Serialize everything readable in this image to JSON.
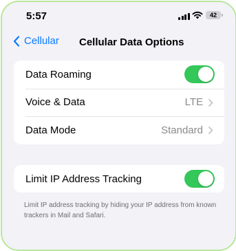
{
  "status_bar": {
    "time": "5:57",
    "battery_level": "42"
  },
  "nav": {
    "back_label": "Cellular",
    "title": "Cellular Data Options"
  },
  "settings": {
    "data_roaming": {
      "label": "Data Roaming",
      "enabled": true
    },
    "voice_data": {
      "label": "Voice & Data",
      "value": "LTE"
    },
    "data_mode": {
      "label": "Data Mode",
      "value": "Standard"
    },
    "limit_ip_tracking": {
      "label": "Limit IP Address Tracking",
      "enabled": true
    },
    "limit_ip_footer": "Limit IP address tracking by hiding your IP address from known trackers in Mail and Safari."
  },
  "colors": {
    "accent": "#0a7aff",
    "toggle_on": "#34c759",
    "background": "#f2f2f7",
    "frame_highlight": "#b8e89a"
  },
  "icons": [
    "signal-icon",
    "wifi-icon",
    "battery-icon",
    "back-chevron-icon",
    "chevron-right-icon"
  ]
}
